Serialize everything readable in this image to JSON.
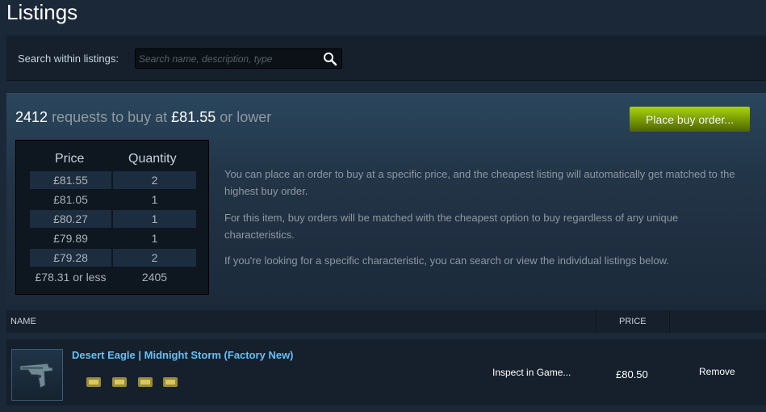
{
  "page": {
    "title": "Listings"
  },
  "search": {
    "label": "Search within listings:",
    "placeholder": "Search name, description, type",
    "value": ""
  },
  "orders": {
    "count": "2412",
    "text_requests": "requests to buy at",
    "price": "£81.55",
    "text_lower": "or lower",
    "buy_button_label": "Place buy order...",
    "table": {
      "headers": [
        "Price",
        "Quantity"
      ],
      "rows": [
        {
          "price": "£81.55",
          "qty": "2"
        },
        {
          "price": "£81.05",
          "qty": "1"
        },
        {
          "price": "£80.27",
          "qty": "1"
        },
        {
          "price": "£79.89",
          "qty": "1"
        },
        {
          "price": "£79.28",
          "qty": "2"
        },
        {
          "price": "£78.31 or less",
          "qty": "2405"
        }
      ]
    },
    "info": [
      "You can place an order to buy at a specific price, and the cheapest listing will automatically get matched to the highest buy order.",
      "For this item, buy orders will be matched with the cheapest option to buy regardless of any unique characteristics.",
      "If you're looking for a specific characteristic, you can search or view the individual listings below."
    ]
  },
  "listings": {
    "columns": {
      "name": "NAME",
      "price": "PRICE"
    },
    "rows": [
      {
        "name": "Desert Eagle | Midnight Storm (Factory New)",
        "inspect_label": "Inspect in Game...",
        "price": "£80.50",
        "remove_label": "Remove",
        "sticker_count": 4
      }
    ]
  },
  "colors": {
    "background": "#1b2838",
    "accent_green": "#a4d007",
    "link_blue": "#66c0f4"
  }
}
